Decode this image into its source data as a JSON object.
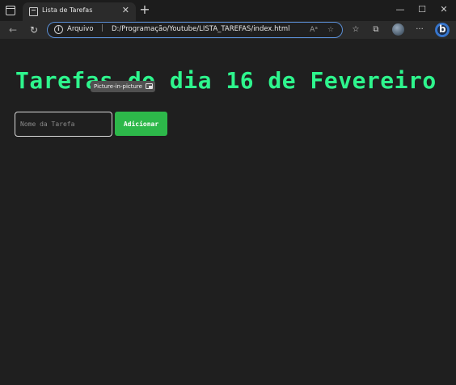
{
  "browser": {
    "tab_title": "Lista de Tarefas",
    "tab_close": "✕",
    "new_tab": "+",
    "window_controls": {
      "minimize": "—",
      "maximize": "☐",
      "close": "✕"
    },
    "nav": {
      "back": "←",
      "refresh": "↻"
    },
    "address": {
      "scheme_label": "Arquivo",
      "separator": "|",
      "url": "D:/Programação/Youtube/LISTA_TAREFAS/index.html",
      "info": "i",
      "read_aloud": "Aᵃ",
      "favorite": "☆"
    },
    "toolbar_icons": {
      "favorites": "☆",
      "collections": "⧉",
      "more": "···"
    },
    "accent_color": "#5b8fd6"
  },
  "page": {
    "heading": "Tarefas do dia 16 de Fevereiro",
    "pip_label": "Picture-in-picture",
    "input_placeholder": "Nome da Tarefa",
    "add_button": "Adicionar",
    "heading_color": "#2ef58d",
    "button_color": "#2db84a",
    "background_color": "#1f1f1f"
  }
}
